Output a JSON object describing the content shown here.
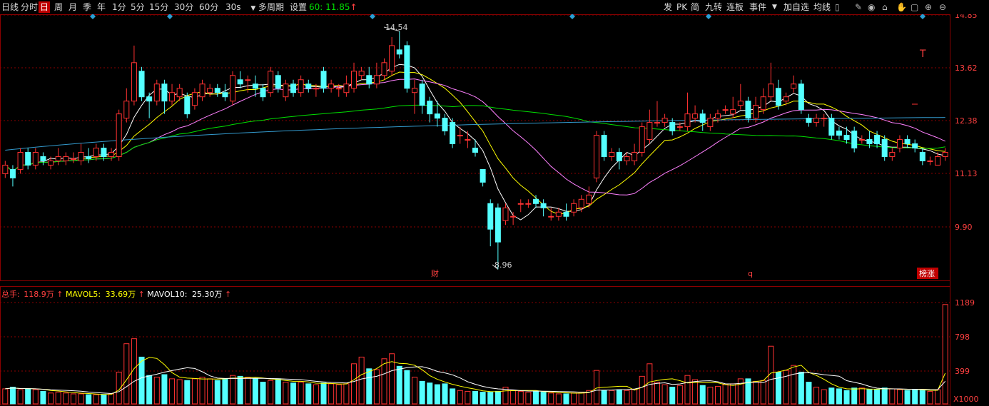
{
  "toolbar": {
    "periods": [
      "日线",
      "分时",
      "日",
      "周",
      "月",
      "季",
      "年",
      "1分",
      "5分",
      "15分",
      "30分",
      "60分",
      "30s"
    ],
    "active_period": "日",
    "multi_period": "多周期",
    "settings": "设置",
    "readout_label": "60:",
    "readout_value": "11.85",
    "right_buttons": [
      "发",
      "PK",
      "简",
      "九转",
      "连板",
      "事件",
      "加自选",
      "均线"
    ]
  },
  "price_axis": {
    "ticks": [
      "14.85",
      "13.62",
      "12.38",
      "11.13",
      "9.90"
    ]
  },
  "annotations": {
    "high": "14.54",
    "low": "8.96",
    "event_cai": "财",
    "event_q": "q",
    "badge": "榜涨",
    "t_marker": "T"
  },
  "volume_header": {
    "total_label": "总手:",
    "total_value": "118.9万",
    "ma5_label": "MAVOL5:",
    "ma5_value": "33.69万",
    "ma10_label": "MAVOL10:",
    "ma10_value": "25.30万"
  },
  "volume_axis": {
    "ticks": [
      "1189",
      "798",
      "399"
    ],
    "unit": "X1000"
  },
  "colors": {
    "up": "#ff3232",
    "down": "#54ffff",
    "ma5": "#ffffff",
    "ma10": "#ffff00",
    "ma20": "#ff80ff",
    "ma60": "#00e000",
    "ma250": "#3399cc",
    "grid": "#8b0000",
    "axis_text": "#ff4040"
  },
  "chart_data": {
    "type": "candlestick",
    "price_range": [
      8.7,
      14.9
    ],
    "volume_range": [
      0,
      1230
    ],
    "candles": [
      [
        11.2,
        11.4,
        11.5,
        11.1
      ],
      [
        11.3,
        11.1,
        11.4,
        10.9
      ],
      [
        11.3,
        11.7,
        11.8,
        11.2
      ],
      [
        11.7,
        11.4,
        11.8,
        11.3
      ],
      [
        11.4,
        11.7,
        11.8,
        11.3
      ],
      [
        11.6,
        11.5,
        11.7,
        11.4
      ],
      [
        11.4,
        11.5,
        11.6,
        11.3
      ],
      [
        11.5,
        11.6,
        11.8,
        11.4
      ],
      [
        11.5,
        11.6,
        11.7,
        11.4
      ],
      [
        11.55,
        11.55,
        11.7,
        11.45
      ],
      [
        11.5,
        11.7,
        11.9,
        11.4
      ],
      [
        11.6,
        11.55,
        11.8,
        11.45
      ],
      [
        11.6,
        11.8,
        11.9,
        11.5
      ],
      [
        11.8,
        11.6,
        11.9,
        11.5
      ],
      [
        11.6,
        11.7,
        11.8,
        11.5
      ],
      [
        11.6,
        12.6,
        12.7,
        11.5
      ],
      [
        12.5,
        12.9,
        13.2,
        12.4
      ],
      [
        12.9,
        13.8,
        14.2,
        12.8
      ],
      [
        13.6,
        13.0,
        13.7,
        12.9
      ],
      [
        13.0,
        12.9,
        13.1,
        12.5
      ],
      [
        12.9,
        13.3,
        13.4,
        12.8
      ],
      [
        13.3,
        12.9,
        13.4,
        12.6
      ],
      [
        12.9,
        13.1,
        13.3,
        12.8
      ],
      [
        13.0,
        13.2,
        13.3,
        12.9
      ],
      [
        13.0,
        12.6,
        13.1,
        12.5
      ],
      [
        12.8,
        13.1,
        13.2,
        12.7
      ],
      [
        13.0,
        13.3,
        13.4,
        12.9
      ],
      [
        13.1,
        13.2,
        13.3,
        13.0
      ],
      [
        13.2,
        13.1,
        13.3,
        13.0
      ],
      [
        13.1,
        13.0,
        13.3,
        12.9
      ],
      [
        12.9,
        13.5,
        13.6,
        12.8
      ],
      [
        13.4,
        13.3,
        13.6,
        13.2
      ],
      [
        13.4,
        13.4,
        13.5,
        13.1
      ],
      [
        13.3,
        13.2,
        13.5,
        13.0
      ],
      [
        13.2,
        13.0,
        13.3,
        12.9
      ],
      [
        13.1,
        13.6,
        13.7,
        13.0
      ],
      [
        13.5,
        13.2,
        13.6,
        13.1
      ],
      [
        13.0,
        13.3,
        13.4,
        12.9
      ],
      [
        13.3,
        13.1,
        13.4,
        13.0
      ],
      [
        13.1,
        13.4,
        13.5,
        13.0
      ],
      [
        13.3,
        13.2,
        13.4,
        13.1
      ],
      [
        13.2,
        13.2,
        13.3,
        13.0
      ],
      [
        13.6,
        13.2,
        13.7,
        13.1
      ],
      [
        13.2,
        13.3,
        13.4,
        13.1
      ],
      [
        13.2,
        13.2,
        13.3,
        13.0
      ],
      [
        13.1,
        13.3,
        13.5,
        13.0
      ],
      [
        13.2,
        13.6,
        13.8,
        13.1
      ],
      [
        13.5,
        13.6,
        13.7,
        13.4
      ],
      [
        13.5,
        13.3,
        13.7,
        13.2
      ],
      [
        13.3,
        13.5,
        13.8,
        13.2
      ],
      [
        13.5,
        13.8,
        13.9,
        13.4
      ],
      [
        13.6,
        14.2,
        14.4,
        13.5
      ],
      [
        14.1,
        14.0,
        14.54,
        13.9
      ],
      [
        14.2,
        13.2,
        14.3,
        13.1
      ],
      [
        13.1,
        13.2,
        13.4,
        12.6
      ],
      [
        13.3,
        12.8,
        13.4,
        12.6
      ],
      [
        12.9,
        12.6,
        13.0,
        12.4
      ],
      [
        12.6,
        12.5,
        12.9,
        12.3
      ],
      [
        12.5,
        12.2,
        12.6,
        12.1
      ],
      [
        12.4,
        11.9,
        12.5,
        11.8
      ],
      [
        12.1,
        12.1,
        12.3,
        11.9
      ],
      [
        12.0,
        12.0,
        12.2,
        11.8
      ],
      [
        11.8,
        11.7,
        12.0,
        11.6
      ],
      [
        11.3,
        11.0,
        11.3,
        10.9
      ],
      [
        10.5,
        9.9,
        10.6,
        9.5
      ],
      [
        10.4,
        9.6,
        10.5,
        8.96
      ],
      [
        10.1,
        10.4,
        10.5,
        10.0
      ],
      [
        10.2,
        10.2,
        10.3,
        10.0
      ],
      [
        10.5,
        10.5,
        10.6,
        10.3
      ],
      [
        10.5,
        10.5,
        10.6,
        10.4
      ],
      [
        10.6,
        10.5,
        10.7,
        10.4
      ],
      [
        10.5,
        10.4,
        10.6,
        10.2
      ],
      [
        10.2,
        10.2,
        10.4,
        10.1
      ],
      [
        10.2,
        10.3,
        10.4,
        10.1
      ],
      [
        10.3,
        10.2,
        10.5,
        10.1
      ],
      [
        10.3,
        10.5,
        10.6,
        10.2
      ],
      [
        10.4,
        10.6,
        10.7,
        10.3
      ],
      [
        10.5,
        10.7,
        10.9,
        10.4
      ],
      [
        11.1,
        12.1,
        12.2,
        11.0
      ],
      [
        12.1,
        11.6,
        12.2,
        11.5
      ],
      [
        11.6,
        11.7,
        11.8,
        11.5
      ],
      [
        11.7,
        11.5,
        11.8,
        11.3
      ],
      [
        11.5,
        11.6,
        11.7,
        11.4
      ],
      [
        11.5,
        11.7,
        11.9,
        11.4
      ],
      [
        11.7,
        12.3,
        12.4,
        11.6
      ],
      [
        12.0,
        12.4,
        12.7,
        11.9
      ],
      [
        12.4,
        12.4,
        12.9,
        12.3
      ],
      [
        12.4,
        12.5,
        12.6,
        12.3
      ],
      [
        12.4,
        12.2,
        12.5,
        12.1
      ],
      [
        12.3,
        12.3,
        12.4,
        12.2
      ],
      [
        12.3,
        12.6,
        13.1,
        12.2
      ],
      [
        12.5,
        12.6,
        12.8,
        12.4
      ],
      [
        12.6,
        12.4,
        12.7,
        12.2
      ],
      [
        12.3,
        12.5,
        12.6,
        12.2
      ],
      [
        12.5,
        12.6,
        12.7,
        12.4
      ],
      [
        12.7,
        12.7,
        12.8,
        12.6
      ],
      [
        12.6,
        12.7,
        13.0,
        12.5
      ],
      [
        12.8,
        12.9,
        13.3,
        12.7
      ],
      [
        12.9,
        12.5,
        13.0,
        12.4
      ],
      [
        12.5,
        12.8,
        13.0,
        12.4
      ],
      [
        12.7,
        13.0,
        13.2,
        12.6
      ],
      [
        13.0,
        13.3,
        13.8,
        12.9
      ],
      [
        13.2,
        12.8,
        13.4,
        12.7
      ],
      [
        12.9,
        13.0,
        13.1,
        12.8
      ],
      [
        13.2,
        13.3,
        13.5,
        13.1
      ],
      [
        13.3,
        12.7,
        13.4,
        12.6
      ],
      [
        12.5,
        12.4,
        12.6,
        12.3
      ],
      [
        12.4,
        12.5,
        12.6,
        12.3
      ],
      [
        12.5,
        12.5,
        12.6,
        12.3
      ],
      [
        12.5,
        12.1,
        12.6,
        12.0
      ],
      [
        12.2,
        12.1,
        12.3,
        12.0
      ],
      [
        12.1,
        12.0,
        12.3,
        11.9
      ],
      [
        12.2,
        11.8,
        12.3,
        11.7
      ],
      [
        12.0,
        12.0,
        12.1,
        11.9
      ],
      [
        12.0,
        11.9,
        12.2,
        11.8
      ],
      [
        12.1,
        11.9,
        12.2,
        11.8
      ],
      [
        12.0,
        11.6,
        12.1,
        11.5
      ],
      [
        11.6,
        11.7,
        11.8,
        11.5
      ],
      [
        11.8,
        12.0,
        12.1,
        11.7
      ],
      [
        12.0,
        11.9,
        12.1,
        11.8
      ],
      [
        11.9,
        11.8,
        12.0,
        11.7
      ],
      [
        11.7,
        11.5,
        11.8,
        11.4
      ],
      [
        11.5,
        11.5,
        11.6,
        11.4
      ],
      [
        11.4,
        11.6,
        11.7,
        11.4
      ],
      [
        11.6,
        11.7,
        11.8,
        11.5
      ]
    ],
    "volume": [
      180,
      200,
      170,
      180,
      170,
      150,
      130,
      140,
      130,
      120,
      120,
      110,
      110,
      110,
      120,
      380,
      720,
      780,
      560,
      340,
      320,
      350,
      300,
      290,
      280,
      300,
      320,
      300,
      280,
      300,
      340,
      330,
      320,
      300,
      260,
      280,
      300,
      260,
      250,
      260,
      240,
      230,
      250,
      240,
      230,
      240,
      480,
      560,
      420,
      410,
      540,
      600,
      450,
      400,
      320,
      270,
      250,
      230,
      240,
      180,
      160,
      150,
      150,
      140,
      140,
      150,
      200,
      160,
      150,
      140,
      150,
      140,
      130,
      120,
      120,
      130,
      140,
      160,
      400,
      160,
      160,
      170,
      160,
      170,
      330,
      480,
      260,
      230,
      200,
      220,
      340,
      290,
      220,
      200,
      210,
      230,
      240,
      300,
      300,
      270,
      280,
      690,
      380,
      400,
      460,
      380,
      260,
      200,
      170,
      190,
      180,
      160,
      190,
      190,
      170,
      170,
      190,
      180,
      170,
      160,
      170,
      160,
      150,
      170,
      1189
    ]
  }
}
